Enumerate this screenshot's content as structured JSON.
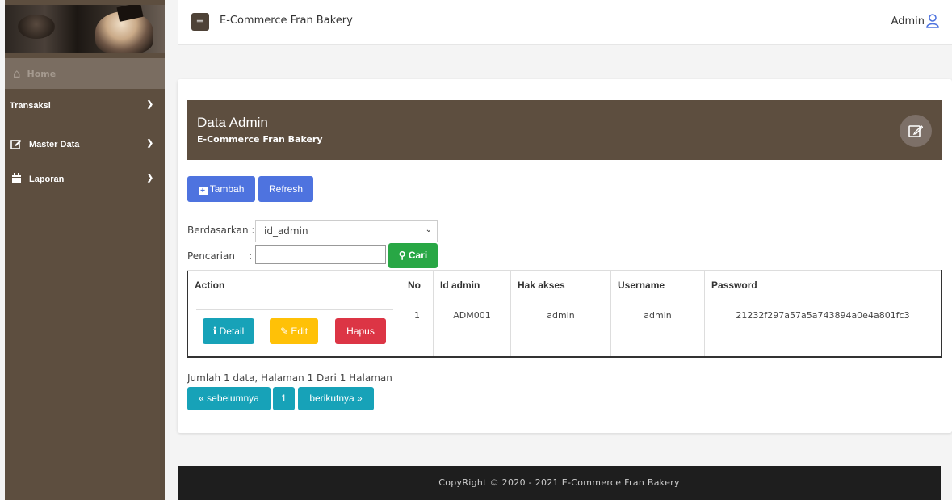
{
  "sidebar": {
    "items": [
      {
        "label": "Home",
        "icon": "home-icon"
      },
      {
        "label": "Transaksi",
        "icon": "",
        "chevron": "chevron-down-icon"
      },
      {
        "label": "Master Data",
        "icon": "edit-icon",
        "chevron": "chevron-down-icon"
      },
      {
        "label": "Laporan",
        "icon": "calendar-icon",
        "chevron": "chevron-down-icon"
      }
    ]
  },
  "topbar": {
    "title": "E-Commerce Fran Bakery",
    "user": "Admin"
  },
  "header": {
    "title": "Data Admin",
    "subtitle": "E-Commerce Fran Bakery"
  },
  "toolbar": {
    "add_label": "Tambah",
    "refresh_label": "Refresh"
  },
  "filter": {
    "by_label": "Berdasarkan :",
    "by_value": "id_admin",
    "search_label": "Pencarian",
    "search_sep": ":",
    "search_value": "",
    "search_button": "Cari"
  },
  "table": {
    "columns": [
      "Action",
      "No",
      "Id admin",
      "Hak akses",
      "Username",
      "Password"
    ],
    "rows": [
      {
        "no": "1",
        "id_admin": "ADM001",
        "hak_akses": "admin",
        "username": "admin",
        "password": "21232f297a57a5a743894a0e4a801fc3"
      }
    ],
    "actions": {
      "detail": "Detail",
      "edit": "Edit",
      "delete": "Hapus"
    }
  },
  "pagination": {
    "info": "Jumlah 1 data, Halaman 1 Dari 1 Halaman",
    "prev": "« sebelumnya",
    "page": "1",
    "next": "berikutnya »"
  },
  "footer": {
    "text": "CopyRight © 2020 - 2021 E-Commerce Fran Bakery"
  },
  "colors": {
    "sidebar": "#5d4e3f",
    "header": "#5d4e3f",
    "primary": "#4e73df",
    "success": "#28a745",
    "info": "#17a2b8",
    "warning": "#ffc107",
    "danger": "#dc3545",
    "footer": "#1e1e1e"
  }
}
